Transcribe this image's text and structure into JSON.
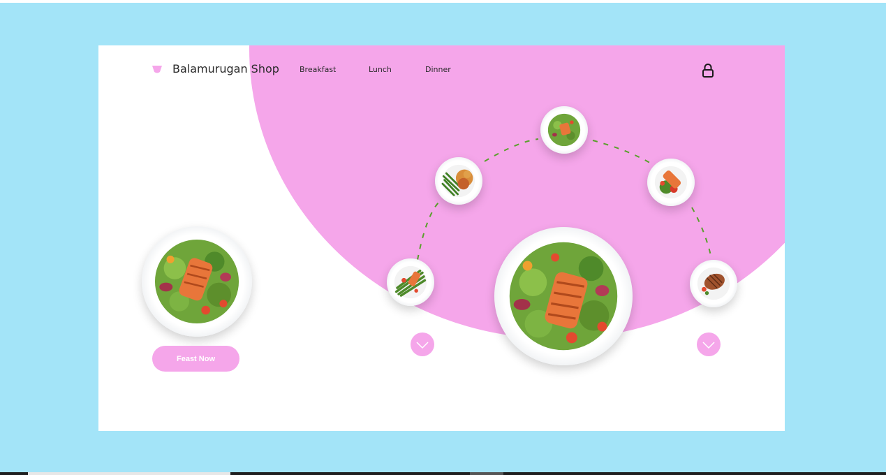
{
  "header": {
    "brand": "Balamurugan Shop",
    "nav": [
      {
        "label": "Breakfast"
      },
      {
        "label": "Lunch"
      },
      {
        "label": "Dinner"
      }
    ]
  },
  "hero": {
    "cta_label": "Feast Now"
  },
  "icons": {
    "logo": "bowl-icon",
    "cart": "lock-icon",
    "scroll_left": "chevron-down-icon",
    "scroll_right": "chevron-down-icon"
  },
  "colors": {
    "background": "#a3e4f8",
    "accent": "#f5a6ea",
    "card": "#ffffff",
    "arc_dash": "#5aa02c",
    "salmon": "#e8763a"
  }
}
